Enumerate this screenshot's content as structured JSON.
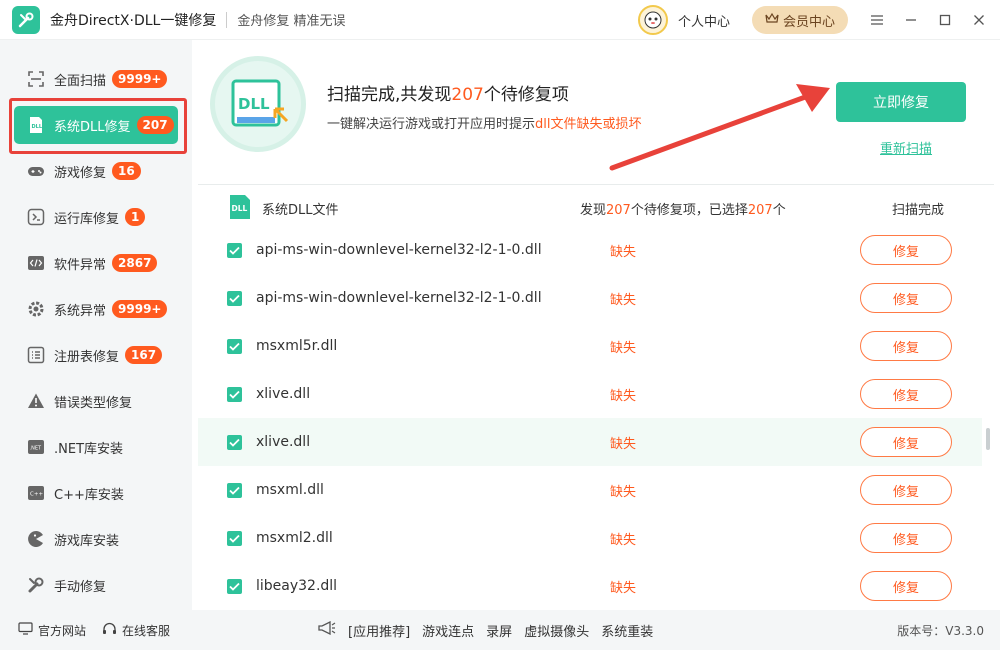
{
  "app": {
    "title": "金舟DirectX·DLL一键修复",
    "slogan": "金舟修复 精准无误",
    "user_center": "个人中心",
    "vip_label": "会员中心"
  },
  "sidebar": {
    "items": [
      {
        "label": "全面扫描",
        "badge": "9999+",
        "icon": "scan-icon"
      },
      {
        "label": "系统DLL修复",
        "badge": "207",
        "icon": "dll-icon"
      },
      {
        "label": "游戏修复",
        "badge": "16",
        "icon": "gamepad-icon"
      },
      {
        "label": "运行库修复",
        "badge": "1",
        "icon": "runtime-icon"
      },
      {
        "label": "软件异常",
        "badge": "2867",
        "icon": "code-icon"
      },
      {
        "label": "系统异常",
        "badge": "9999+",
        "icon": "gear-icon"
      },
      {
        "label": "注册表修复",
        "badge": "167",
        "icon": "list-icon"
      },
      {
        "label": "错误类型修复",
        "badge": "",
        "icon": "warning-icon"
      },
      {
        "label": ".NET库安装",
        "badge": "",
        "icon": "dotnet-icon"
      },
      {
        "label": "C++库安装",
        "badge": "",
        "icon": "cpp-icon"
      },
      {
        "label": "游戏库安装",
        "badge": "",
        "icon": "pacman-icon"
      },
      {
        "label": "手动修复",
        "badge": "",
        "icon": "wrench-icon"
      }
    ]
  },
  "scan": {
    "title_prefix": "扫描完成,共发现",
    "title_count": "207",
    "title_suffix": "个待修复项",
    "sub_prefix": "一键解决运行游戏或打开应用时提示",
    "sub_highlight": "dll文件缺失或损坏",
    "fix_now": "立即修复",
    "rescan": "重新扫描",
    "dll_badge": "DLL"
  },
  "table": {
    "name_header": "系统DLL文件",
    "count_prefix": "发现",
    "found": "207",
    "count_middle": "个待修复项，已选择",
    "selected": "207",
    "count_suffix": "个",
    "status_header": "扫描完成",
    "repair_label": "修复",
    "rows": [
      {
        "file": "api-ms-win-downlevel-kernel32-l2-1-0.dll",
        "status": "缺失"
      },
      {
        "file": "api-ms-win-downlevel-kernel32-l2-1-0.dll",
        "status": "缺失"
      },
      {
        "file": "msxml5r.dll",
        "status": "缺失"
      },
      {
        "file": "xlive.dll",
        "status": "缺失"
      },
      {
        "file": "xlive.dll",
        "status": "缺失"
      },
      {
        "file": "msxml.dll",
        "status": "缺失"
      },
      {
        "file": "msxml2.dll",
        "status": "缺失"
      },
      {
        "file": "libeay32.dll",
        "status": "缺失"
      }
    ]
  },
  "footer": {
    "website": "官方网站",
    "service": "在线客服",
    "recommend": "[应用推荐]",
    "links": [
      "游戏连点",
      "录屏",
      "虚拟摄像头",
      "系统重装"
    ],
    "version": "版本号：V3.3.0"
  },
  "colors": {
    "accent": "#2ec29a",
    "warning": "#ff5a1f",
    "highlight_box": "#e8423a"
  }
}
